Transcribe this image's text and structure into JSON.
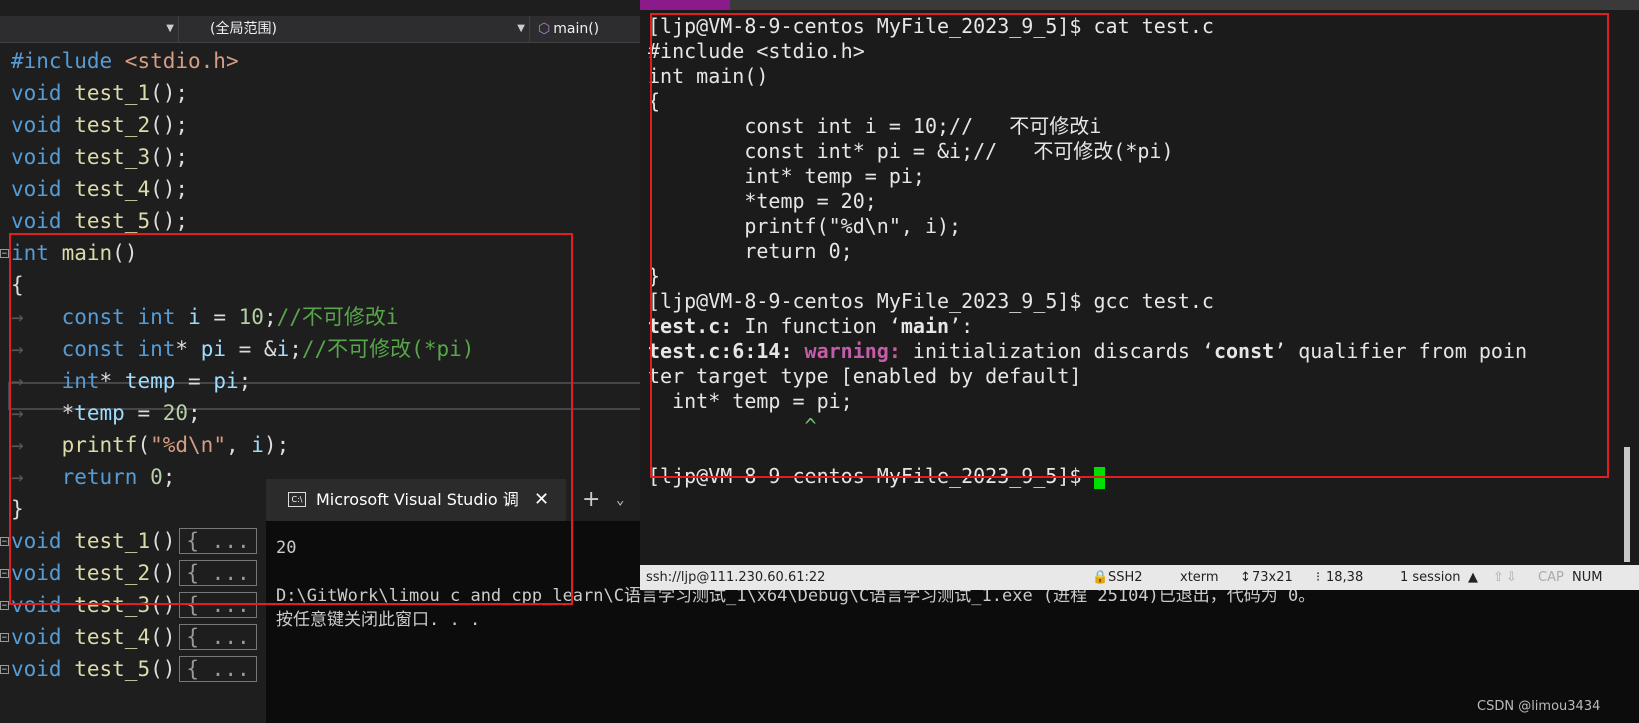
{
  "editor": {
    "dropdown_scope": "(全局范围)",
    "dropdown_function": "main()",
    "lines": [
      {
        "segments": [
          [
            "kw",
            "#include"
          ],
          [
            "str",
            " <stdio.h>"
          ]
        ]
      },
      {
        "segments": [
          [
            "kw",
            "void"
          ],
          [
            "txt",
            " "
          ],
          [
            "fn",
            "test_1"
          ],
          [
            "txt",
            "();"
          ]
        ]
      },
      {
        "segments": [
          [
            "kw",
            "void"
          ],
          [
            "txt",
            " "
          ],
          [
            "fn",
            "test_2"
          ],
          [
            "txt",
            "();"
          ]
        ]
      },
      {
        "segments": [
          [
            "kw",
            "void"
          ],
          [
            "txt",
            " "
          ],
          [
            "fn",
            "test_3"
          ],
          [
            "txt",
            "();"
          ]
        ]
      },
      {
        "segments": [
          [
            "kw",
            "void"
          ],
          [
            "txt",
            " "
          ],
          [
            "fn",
            "test_4"
          ],
          [
            "txt",
            "();"
          ]
        ]
      },
      {
        "segments": [
          [
            "kw",
            "void"
          ],
          [
            "txt",
            " "
          ],
          [
            "fn",
            "test_5"
          ],
          [
            "txt",
            "();"
          ]
        ]
      },
      {
        "fold": true,
        "segments": [
          [
            "kw",
            "int"
          ],
          [
            "txt",
            " "
          ],
          [
            "fn",
            "main"
          ],
          [
            "txt",
            "()"
          ]
        ]
      },
      {
        "segments": [
          [
            "txt",
            "{"
          ]
        ]
      },
      {
        "segments": [
          [
            "tab",
            "→"
          ],
          [
            "txt",
            "   "
          ],
          [
            "kw",
            "const"
          ],
          [
            "txt",
            " "
          ],
          [
            "kw",
            "int"
          ],
          [
            "txt",
            " "
          ],
          [
            "var",
            "i"
          ],
          [
            "txt",
            " = "
          ],
          [
            "num",
            "10"
          ],
          [
            "txt",
            ";"
          ],
          [
            "cm",
            "//不可修改i"
          ]
        ]
      },
      {
        "segments": [
          [
            "tab",
            "→"
          ],
          [
            "txt",
            "   "
          ],
          [
            "kw",
            "const"
          ],
          [
            "txt",
            " "
          ],
          [
            "kw",
            "int"
          ],
          [
            "txt",
            "* "
          ],
          [
            "var",
            "pi"
          ],
          [
            "txt",
            " = &"
          ],
          [
            "var",
            "i"
          ],
          [
            "txt",
            ";"
          ],
          [
            "cm",
            "//不可修改(*pi)"
          ]
        ]
      },
      {
        "segments": [
          [
            "tab",
            "→"
          ],
          [
            "txt",
            "   "
          ],
          [
            "kw",
            "int"
          ],
          [
            "txt",
            "* "
          ],
          [
            "var",
            "temp"
          ],
          [
            "txt",
            " = "
          ],
          [
            "var",
            "pi"
          ],
          [
            "txt",
            ";"
          ]
        ]
      },
      {
        "segments": [
          [
            "tab",
            "→"
          ],
          [
            "txt",
            "   *"
          ],
          [
            "var",
            "temp"
          ],
          [
            "txt",
            " = "
          ],
          [
            "num",
            "20"
          ],
          [
            "txt",
            ";"
          ]
        ]
      },
      {
        "segments": [
          [
            "tab",
            "→"
          ],
          [
            "txt",
            "   "
          ],
          [
            "fn",
            "printf"
          ],
          [
            "txt",
            "("
          ],
          [
            "str",
            "\"%d\\n\""
          ],
          [
            "txt",
            ", "
          ],
          [
            "var",
            "i"
          ],
          [
            "txt",
            ");"
          ]
        ]
      },
      {
        "segments": [
          [
            "tab",
            "→"
          ],
          [
            "txt",
            "   "
          ],
          [
            "kw",
            "return"
          ],
          [
            "txt",
            " "
          ],
          [
            "num",
            "0"
          ],
          [
            "txt",
            ";"
          ]
        ]
      },
      {
        "segments": [
          [
            "txt",
            "}"
          ]
        ]
      },
      {
        "fold": true,
        "segments": [
          [
            "kw",
            "void"
          ],
          [
            "txt",
            " "
          ],
          [
            "fn",
            "test_1"
          ],
          [
            "txt",
            "()"
          ],
          [
            "col",
            "{ ..."
          ]
        ]
      },
      {
        "fold": true,
        "segments": [
          [
            "kw",
            "void"
          ],
          [
            "txt",
            " "
          ],
          [
            "fn",
            "test_2"
          ],
          [
            "txt",
            "()"
          ],
          [
            "col",
            "{ ..."
          ]
        ]
      },
      {
        "fold": true,
        "segments": [
          [
            "kw",
            "void"
          ],
          [
            "txt",
            " "
          ],
          [
            "fn",
            "test_3"
          ],
          [
            "txt",
            "()"
          ],
          [
            "col",
            "{ ..."
          ]
        ]
      },
      {
        "fold": true,
        "segments": [
          [
            "kw",
            "void"
          ],
          [
            "txt",
            " "
          ],
          [
            "fn",
            "test_4"
          ],
          [
            "txt",
            "()"
          ],
          [
            "col",
            "{ ..."
          ]
        ]
      },
      {
        "fold": true,
        "segments": [
          [
            "kw",
            "void"
          ],
          [
            "txt",
            " "
          ],
          [
            "fn",
            "test_5"
          ],
          [
            "txt",
            "()"
          ],
          [
            "col",
            "{ ..."
          ]
        ]
      }
    ]
  },
  "console": {
    "tab_icon": "C:\\",
    "tab_title": "Microsoft Visual Studio 调",
    "close_glyph": "✕",
    "new_tab_glyph": "+",
    "menu_glyph": "⌄",
    "output": [
      "20",
      "",
      "D:\\GitWork\\limou_c_and_cpp_learn\\C语言学习测试_1\\x64\\Debug\\C语言学习测试_1.exe (进程 25104)已退出，代码为 0。",
      "按任意键关闭此窗口. . ."
    ]
  },
  "terminal": {
    "lines": [
      {
        "segments": [
          [
            "txt",
            "[ljp@VM-8-9-centos MyFile_2023_9_5]$ cat test.c"
          ]
        ]
      },
      {
        "segments": [
          [
            "txt",
            "#include <stdio.h>"
          ]
        ]
      },
      {
        "segments": [
          [
            "txt",
            "int main()"
          ]
        ]
      },
      {
        "segments": [
          [
            "txt",
            "{"
          ]
        ]
      },
      {
        "segments": [
          [
            "txt",
            "        const int i = 10;//   不可修改i"
          ]
        ]
      },
      {
        "segments": [
          [
            "txt",
            "        const int* pi = &i;//   不可修改(*pi)"
          ]
        ]
      },
      {
        "segments": [
          [
            "txt",
            "        int* temp = pi;"
          ]
        ]
      },
      {
        "segments": [
          [
            "txt",
            "        *temp = 20;"
          ]
        ]
      },
      {
        "segments": [
          [
            "txt",
            "        printf(\"%d\\n\", i);"
          ]
        ]
      },
      {
        "segments": [
          [
            "txt",
            "        return 0;"
          ]
        ]
      },
      {
        "segments": [
          [
            "txt",
            "}"
          ]
        ]
      },
      {
        "segments": [
          [
            "txt",
            "[ljp@VM-8-9-centos MyFile_2023_9_5]$ gcc test.c"
          ]
        ]
      },
      {
        "segments": [
          [
            "b",
            "test.c:"
          ],
          [
            "txt",
            " In function ‘"
          ],
          [
            "b",
            "main"
          ],
          [
            "txt",
            "’:"
          ]
        ]
      },
      {
        "segments": [
          [
            "b",
            "test.c:6:14: "
          ],
          [
            "warn",
            "warning: "
          ],
          [
            "txt",
            "initialization discards ‘"
          ],
          [
            "b",
            "const"
          ],
          [
            "txt",
            "’ qualifier from poin"
          ]
        ]
      },
      {
        "segments": [
          [
            "txt",
            "ter target type [enabled by default]"
          ]
        ]
      },
      {
        "segments": [
          [
            "txt",
            "  int* temp = pi;"
          ]
        ]
      },
      {
        "segments": [
          [
            "caret",
            "             ^"
          ]
        ]
      },
      {
        "segments": [
          [
            "txt",
            ""
          ]
        ]
      },
      {
        "segments": [
          [
            "txt",
            "[ljp@VM-8-9-centos MyFile_2023_9_5]$ "
          ]
        ],
        "cursor": true
      }
    ]
  },
  "status_bar": {
    "connection": "ssh://ljp@111.230.60.61:22",
    "protocol": "SSH2",
    "term_type": "xterm",
    "size": "73x21",
    "position": "18,38",
    "sessions": "1 session",
    "cap": "CAP",
    "num": "NUM"
  },
  "watermark": "CSDN @limou3434"
}
